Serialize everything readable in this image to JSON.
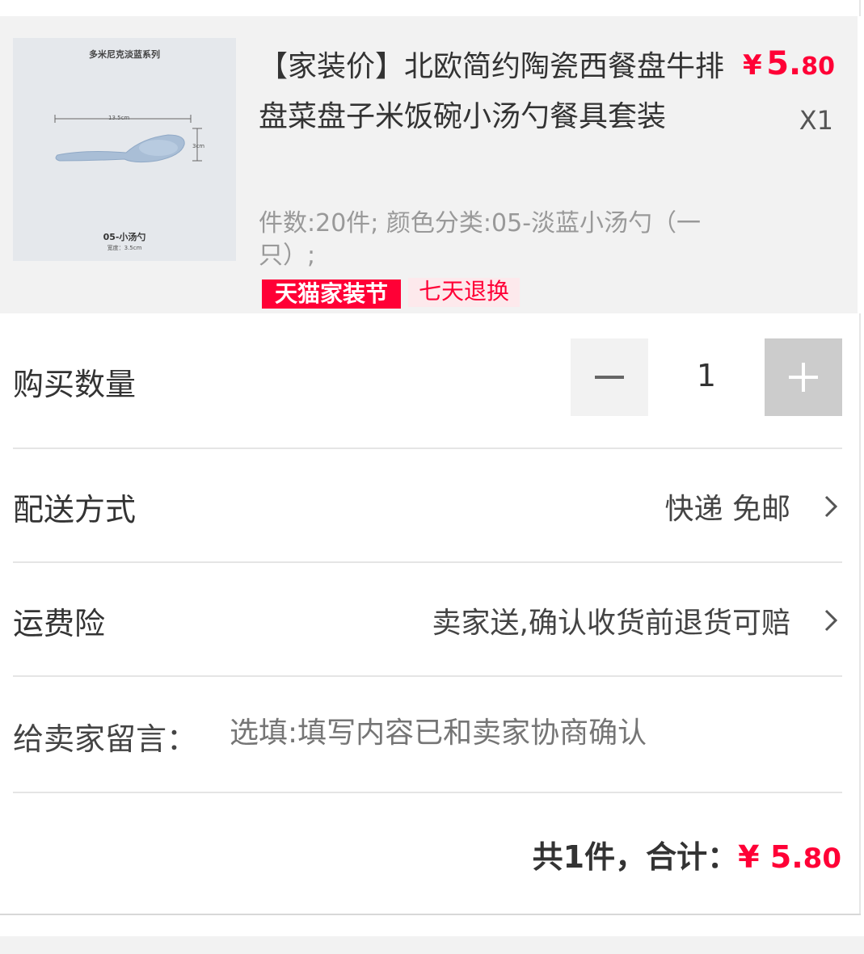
{
  "product": {
    "image": {
      "series_text": "多米尼克淡蓝系列",
      "length_text": "13.5cm",
      "height_text": "3cm",
      "variant_text": "05-小汤勺",
      "width_text": "宽度：3.5cm"
    },
    "title": "【家装价】北欧简约陶瓷西餐盘牛排盘菜盘子米饭碗小汤勺餐具套装",
    "price_symbol": "¥",
    "price_int": "5.",
    "price_dec": "80",
    "quantity_label": "X1",
    "sku_text": "件数:20件; 颜色分类:05-淡蓝小汤勺（一只）;",
    "tags": [
      "天猫家装节",
      "七天退换"
    ]
  },
  "quantity_row": {
    "label": "购买数量",
    "value": "1",
    "minus_icon": "minus-icon",
    "plus_icon": "plus-icon"
  },
  "delivery_row": {
    "label": "配送方式",
    "value": "快递 免邮"
  },
  "insurance_row": {
    "label": "运费险",
    "value": "卖家送,确认收货前退货可赔"
  },
  "message_row": {
    "label": "给卖家留言：",
    "placeholder": "选填:填写内容已和卖家协商确认"
  },
  "summary": {
    "prefix": "共1件，合计：",
    "symbol": "¥ ",
    "int": "5.",
    "dec": "80"
  },
  "colors": {
    "accent": "#ff0036",
    "card_bg": "#f2f2f2"
  }
}
